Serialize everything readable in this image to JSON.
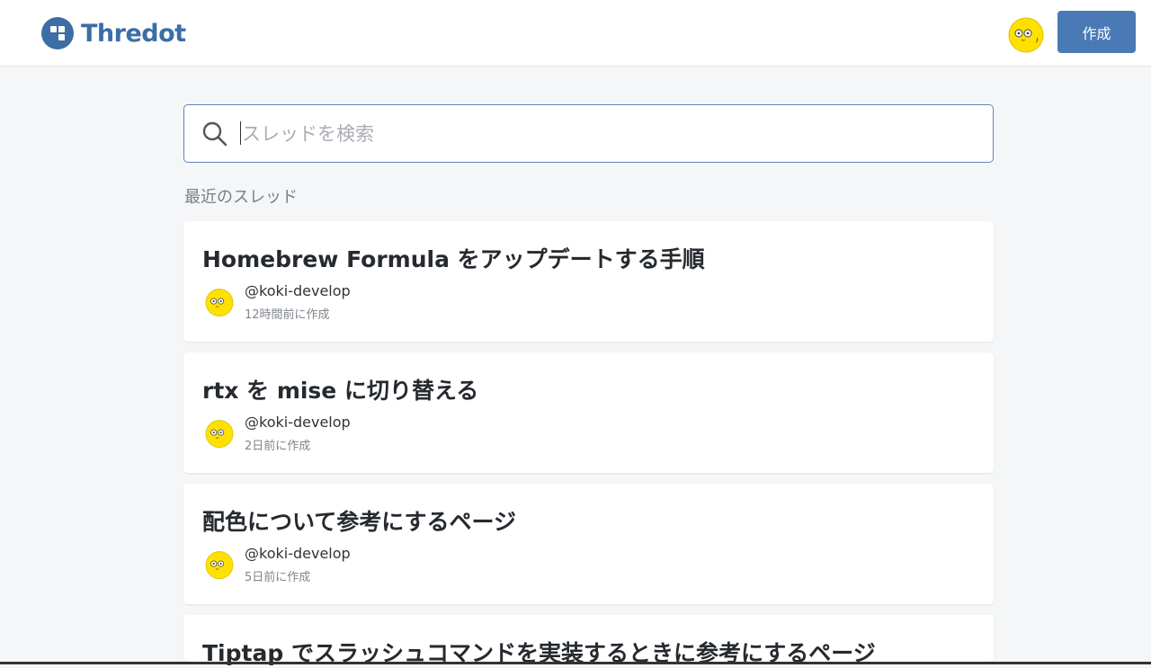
{
  "header": {
    "logo_text": "Thredot",
    "create_label": "作成"
  },
  "search": {
    "placeholder": "スレッドを検索",
    "value": ""
  },
  "section_title": "最近のスレッド",
  "threads": [
    {
      "title": "Homebrew Formula をアップデートする手順",
      "author": "@koki-develop",
      "time": "12時間前に作成"
    },
    {
      "title": "rtx を mise に切り替える",
      "author": "@koki-develop",
      "time": "2日前に作成"
    },
    {
      "title": "配色について参考にするページ",
      "author": "@koki-develop",
      "time": "5日前に作成"
    },
    {
      "title": "Tiptap でスラッシュコマンドを実装するときに参考にするページ",
      "author": "",
      "time": ""
    }
  ],
  "colors": {
    "brand": "#3b6ea5",
    "button": "#4a7ab5",
    "background": "#f5f6f7"
  },
  "icons": [
    "logo-icon",
    "search-icon",
    "avatar-chick-icon"
  ]
}
